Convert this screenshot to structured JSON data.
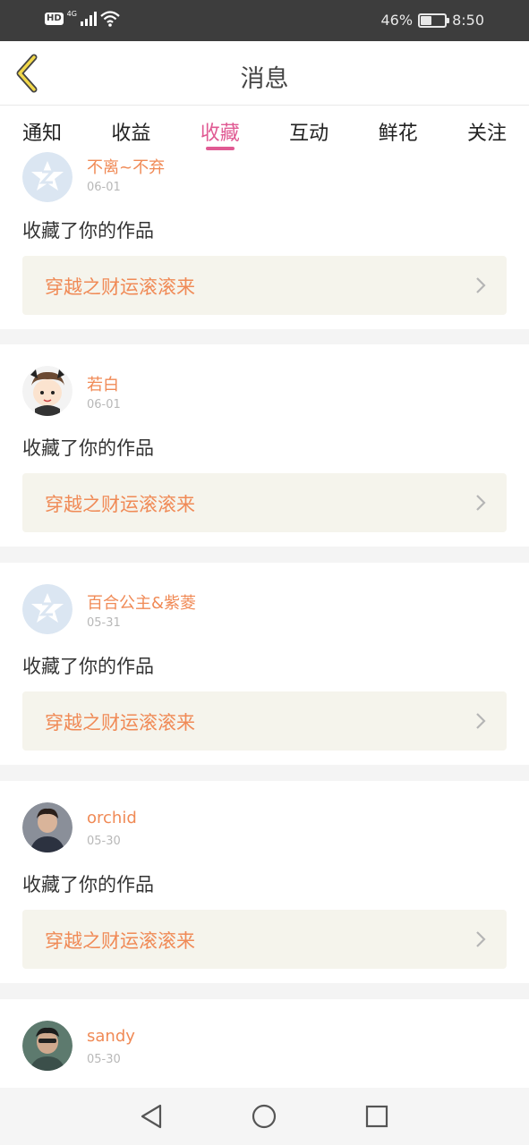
{
  "status_bar": {
    "hd": "HD",
    "network": "4G",
    "battery_percent": "46%",
    "battery_level": 0.46,
    "time": "8:50"
  },
  "header": {
    "title": "消息",
    "back_icon": "chevron-left-icon"
  },
  "tabs": [
    {
      "label": "通知",
      "active": false
    },
    {
      "label": "收益",
      "active": false
    },
    {
      "label": "收藏",
      "active": true
    },
    {
      "label": "互动",
      "active": false
    },
    {
      "label": "鲜花",
      "active": false
    },
    {
      "label": "关注",
      "active": false
    }
  ],
  "notifications": [
    {
      "username": "不离~不弃",
      "date": "06-01",
      "action": "收藏了你的作品",
      "work_title": "穿越之财运滚滚来",
      "avatar": "default-avatar-icon"
    },
    {
      "username": "若白",
      "date": "06-01",
      "action": "收藏了你的作品",
      "work_title": "穿越之财运滚滚来",
      "avatar": "cartoon-avatar"
    },
    {
      "username": "百合公主&紫菱",
      "date": "05-31",
      "action": "收藏了你的作品",
      "work_title": "穿越之财运滚滚来",
      "avatar": "default-avatar-icon"
    },
    {
      "username": "orchid",
      "date": "05-30",
      "action": "收藏了你的作品",
      "work_title": "穿越之财运滚滚来",
      "avatar": "photo-avatar"
    },
    {
      "username": "sandy",
      "date": "05-30",
      "action": "",
      "work_title": "",
      "avatar": "photo-avatar"
    }
  ],
  "nav_bar": {
    "back": "triangle-back-icon",
    "home": "circle-home-icon",
    "recents": "square-recents-icon"
  },
  "colors": {
    "accent": "#e05a93",
    "username": "#f08a56",
    "work_bg": "#f5f4ec",
    "status_bar": "#3d3d3d"
  }
}
